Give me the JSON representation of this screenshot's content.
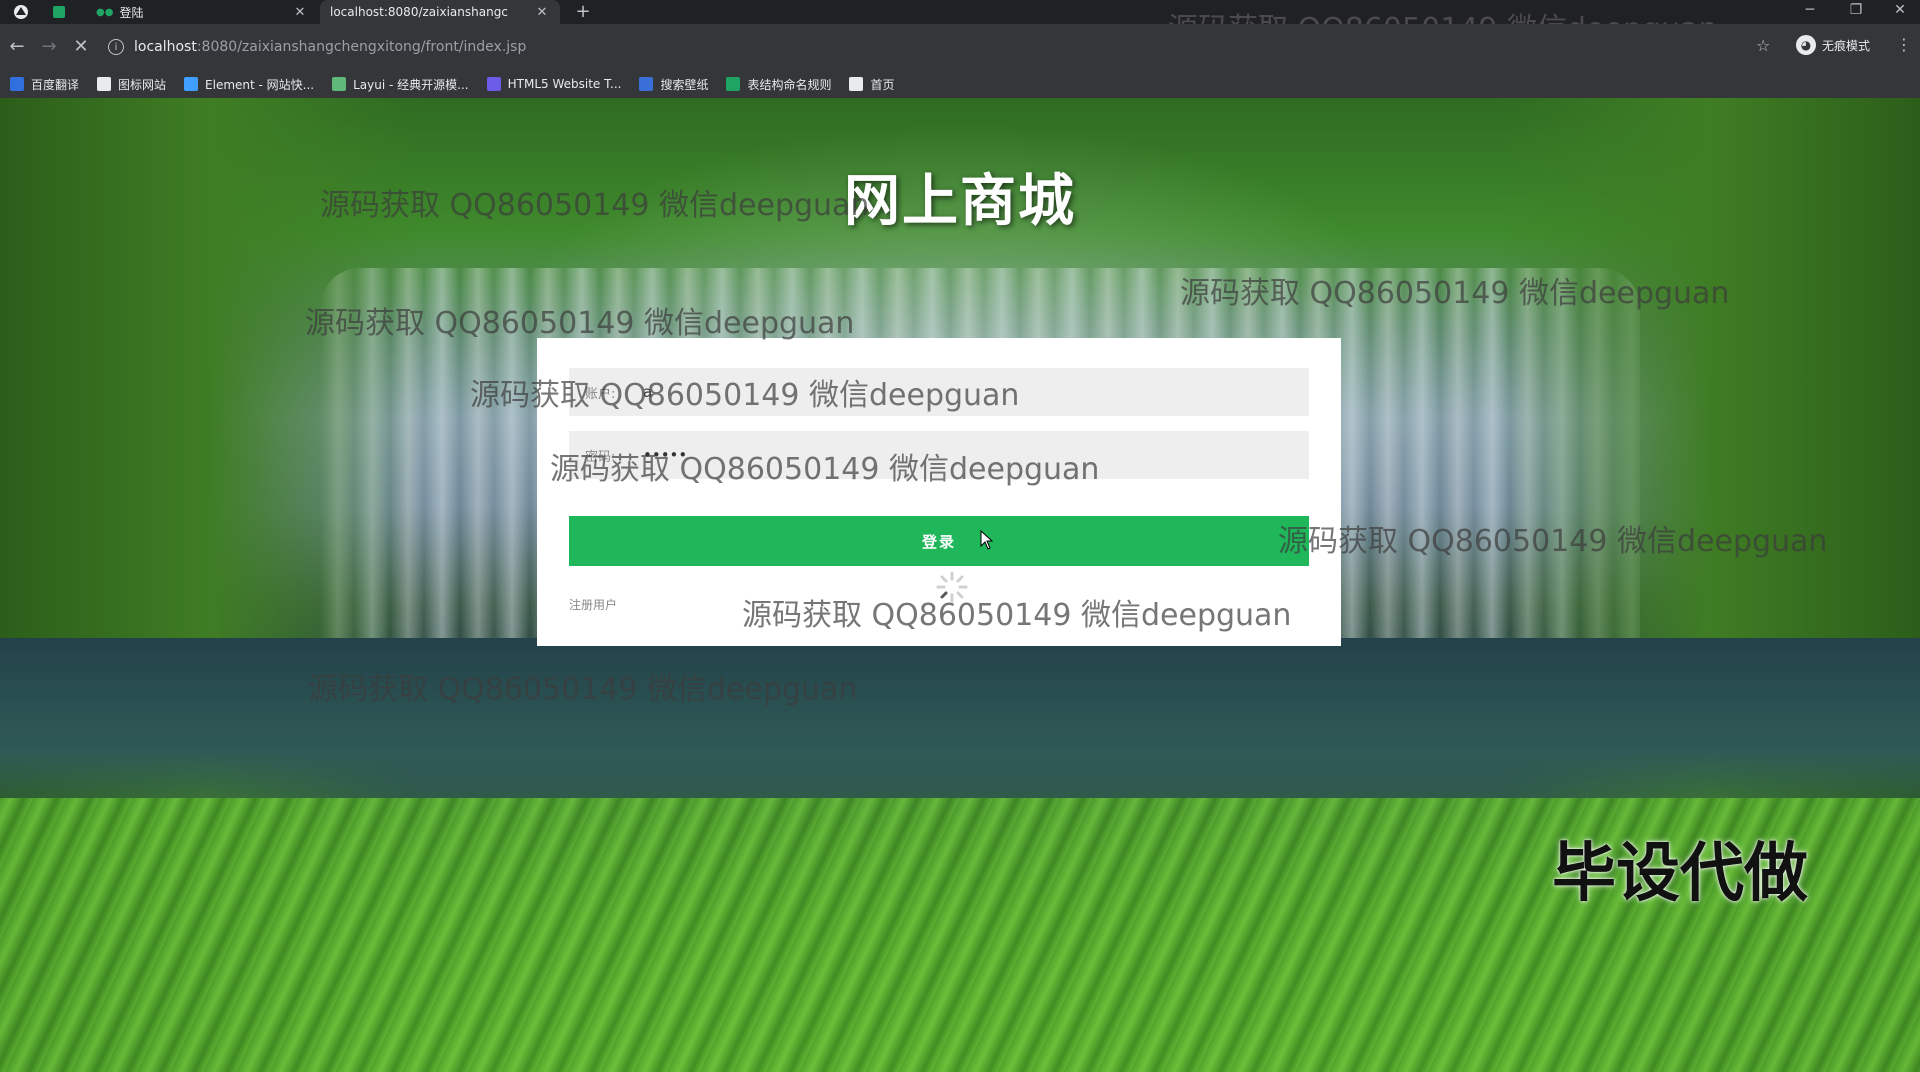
{
  "browser": {
    "tabs": [
      {
        "label": "登陆",
        "active": false
      },
      {
        "label": "localhost:8080/zaixianshangc",
        "active": true
      }
    ],
    "url_host": "localhost",
    "url_path": ":8080/zaixianshangchengxitong/front/index.jsp",
    "incognito_label": "无痕模式",
    "bookmarks": [
      {
        "label": "百度翻译",
        "icon": "baidu-translate-icon",
        "color": "#2f6fde"
      },
      {
        "label": "图标网站",
        "icon": "flag-icon",
        "color": "#e8eaed"
      },
      {
        "label": "Element - 网站快...",
        "icon": "element-icon",
        "color": "#409eff"
      },
      {
        "label": "Layui - 经典开源模...",
        "icon": "layui-icon",
        "color": "#5fb878"
      },
      {
        "label": "HTML5 Website T...",
        "icon": "html5-icon",
        "color": "#6c5ce7"
      },
      {
        "label": "搜索壁纸",
        "icon": "wallpaper-icon",
        "color": "#3a6fd8"
      },
      {
        "label": "表结构命名规则",
        "icon": "sheet-icon",
        "color": "#1fa463"
      },
      {
        "label": "首页",
        "icon": "globe-icon",
        "color": "#e8eaed"
      }
    ]
  },
  "page": {
    "title": "网上商城",
    "login": {
      "account_label": "账户:",
      "account_value": "a",
      "password_label": "密码:",
      "password_value": "•••••",
      "submit_label": "登录",
      "register_link": "注册用户"
    },
    "watermarks": [
      "源码获取 QQ86050149 微信deepguan",
      "源码获取 QQ86050149 微信deepguan",
      "源码获取 QQ86050149 微信deepguan",
      "源码获取 QQ86050149 微信deepguan",
      "源码获取 QQ86050149 微信deepguan",
      "源码获取 QQ86050149 微信deepguan",
      "源码获取 QQ86050149 微信deepguan",
      "源码获取 QQ86050149 微信deepguan",
      "源码获取 QQ86050149 微信deepguan"
    ],
    "corner_ad": "毕设代做"
  },
  "colors": {
    "login_button": "#1fb75a",
    "card_bg": "#ffffff",
    "field_bg": "#eeeeee"
  }
}
